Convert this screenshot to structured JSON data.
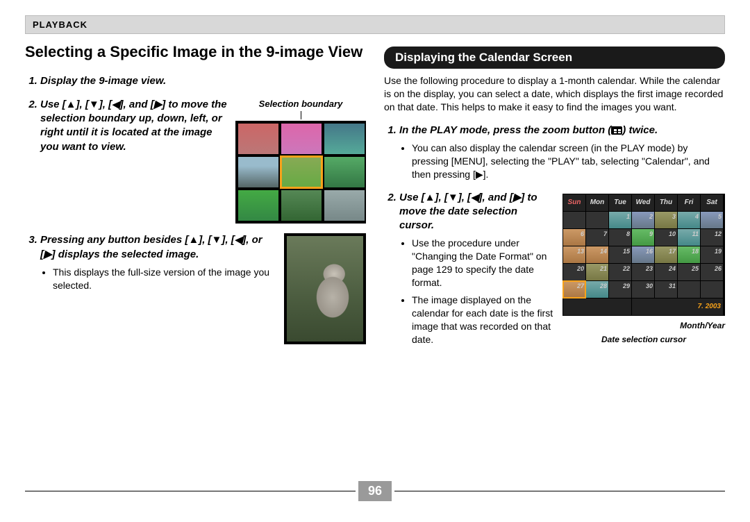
{
  "header": {
    "section": "PLAYBACK"
  },
  "left": {
    "title": "Selecting a Specific Image in the 9-image View",
    "step1": "Display the 9-image view.",
    "step2": "Use [▲], [▼], [◀], and [▶] to move the selection boundary up, down, left, or right until it is located at the image you want to view.",
    "selection_caption": "Selection boundary",
    "step3": "Pressing any button besides [▲], [▼], [◀], or [▶] displays the selected image.",
    "step3_bullet": "This displays the full-size version of the image you selected."
  },
  "right": {
    "pill_title": "Displaying the Calendar Screen",
    "intro": "Use the following procedure to display a 1-month calendar. While the calendar is on the display, you can select a date, which displays the first image recorded on that date. This helps to make it easy to find the images you want.",
    "step1_a": "In the PLAY mode, press the zoom button (",
    "step1_b": ") twice.",
    "step1_bullet": "You can also display the calendar screen (in the PLAY mode) by pressing [MENU], selecting the \"PLAY\" tab, selecting \"Calendar\", and then pressing [▶].",
    "step2": "Use [▲], [▼], [◀], and [▶] to move the date selection cursor.",
    "step2_b1": "Use the procedure under \"Changing the Date Format\" on page 129 to specify the date format.",
    "step2_b2": "The image displayed on the calendar for each date is the first image that was recorded on that date.",
    "calendar": {
      "headers": [
        "Sun",
        "Mon",
        "Tue",
        "Wed",
        "Thu",
        "Fri",
        "Sat"
      ],
      "footer": "7. 2003",
      "caption_month": "Month/Year",
      "caption_cursor": "Date selection cursor"
    }
  },
  "page_number": "96"
}
